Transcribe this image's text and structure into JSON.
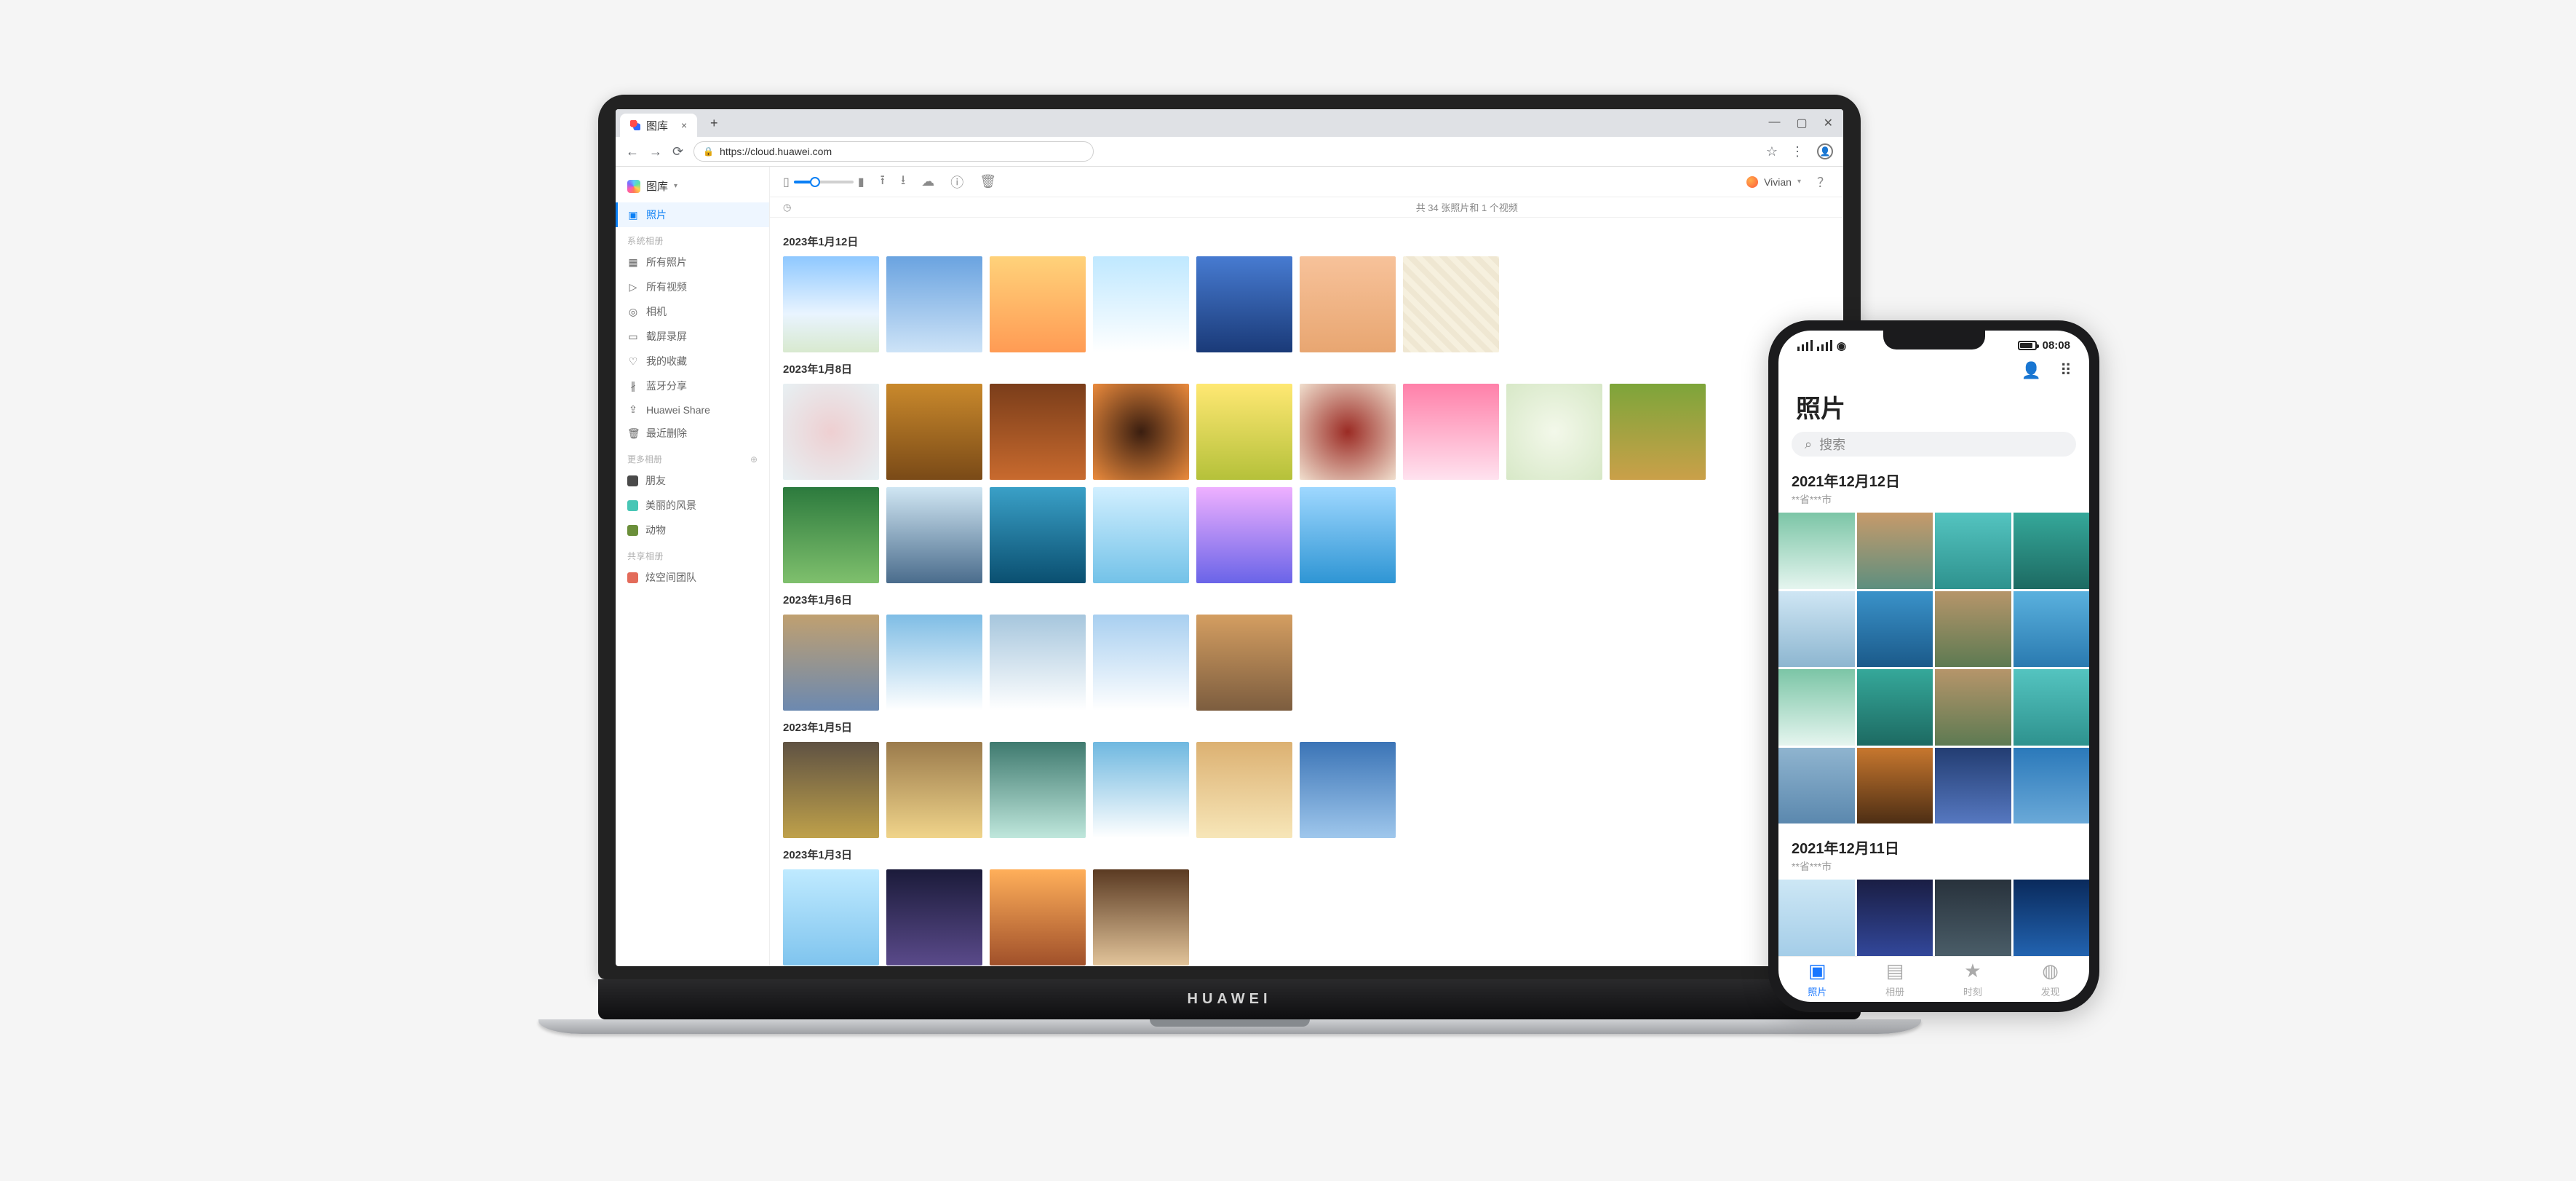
{
  "browser": {
    "tab_title": "图库",
    "url": "https://cloud.huawei.com"
  },
  "app": {
    "brand": "图库",
    "user_name": "Vivian",
    "summary": "共 34 张照片和 1 个视频"
  },
  "sidebar": {
    "group_system": "系统相册",
    "group_more": "更多相册",
    "group_shared": "共享相册",
    "items": {
      "photos": "照片",
      "all_photos": "所有照片",
      "all_videos": "所有视频",
      "camera": "相机",
      "screenshots": "截屏录屏",
      "favorites": "我的收藏",
      "bluetooth": "蓝牙分享",
      "hw_share": "Huawei Share",
      "trash": "最近删除",
      "friends": "朋友",
      "scenery": "美丽的风景",
      "animals": "动物",
      "team": "炫空间团队"
    }
  },
  "dates": {
    "d1": "2023年1月12日",
    "d2": "2023年1月8日",
    "d3": "2023年1月6日",
    "d4": "2023年1月5日",
    "d5": "2023年1月3日"
  },
  "phone": {
    "time": "08:08",
    "title": "照片",
    "search_placeholder": "搜索",
    "date1": "2021年12月12日",
    "sub1": "**省***市",
    "date2": "2021年12月11日",
    "sub2": "**省***市",
    "nav": {
      "photos": "照片",
      "albums": "相册",
      "moments": "时刻",
      "discover": "发现"
    }
  },
  "laptop_brand": "HUAWEI"
}
